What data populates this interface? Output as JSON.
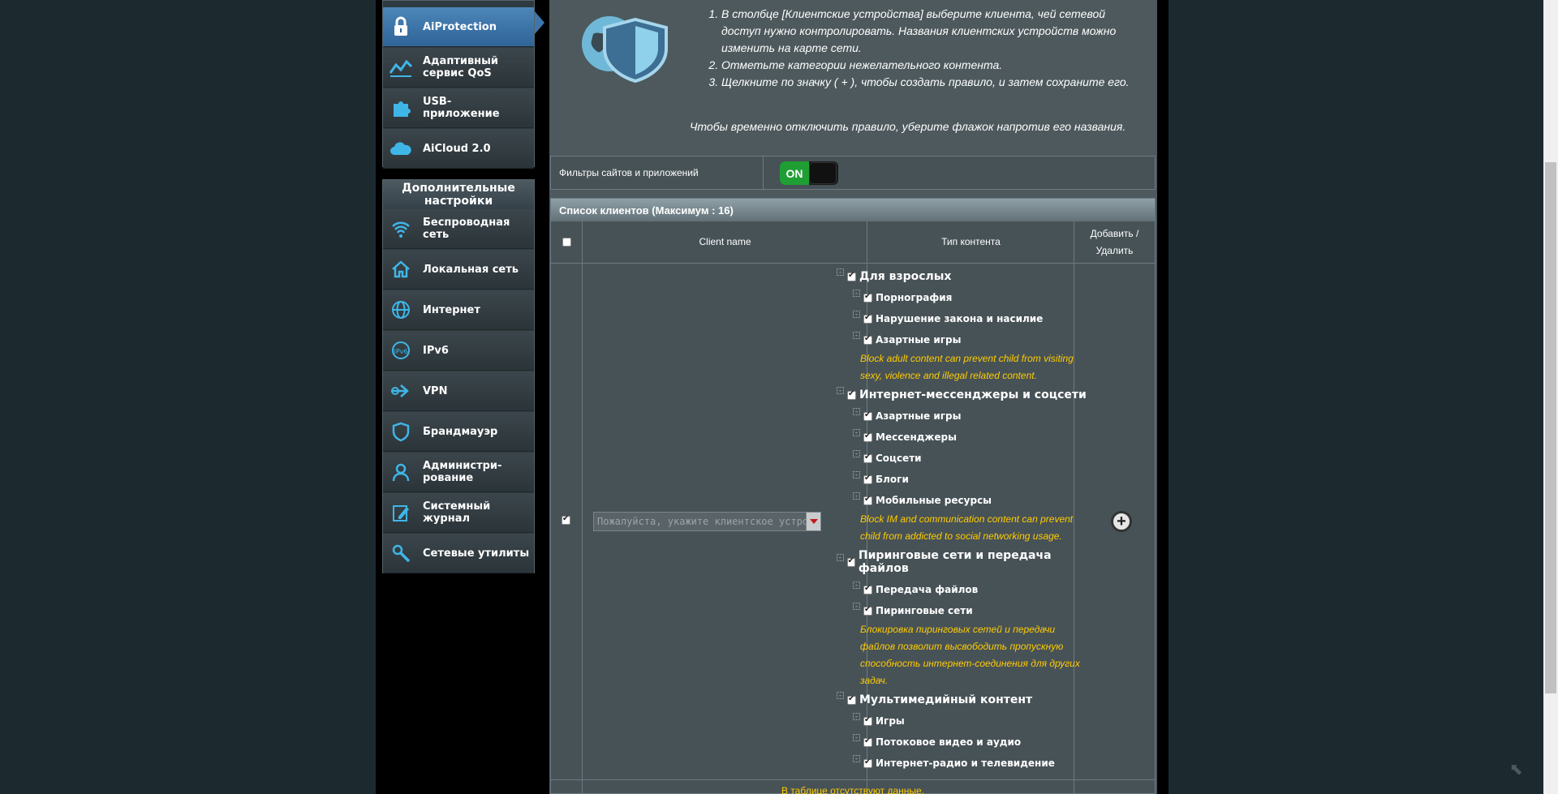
{
  "sidebar": {
    "top_items": [
      {
        "label": "AiProtection",
        "icon": "lock-icon",
        "active": true
      },
      {
        "label": "Адаптивный\nсервис QoS",
        "icon": "qos-icon"
      },
      {
        "label": "USB-\nприложение",
        "icon": "puzzle-icon"
      },
      {
        "label": "AiCloud 2.0",
        "icon": "cloud-icon"
      }
    ],
    "advanced_header": "Дополнительные настройки",
    "advanced_items": [
      {
        "label": "Беспроводная\nсеть",
        "icon": "wifi-icon"
      },
      {
        "label": "Локальная сеть",
        "icon": "home-icon"
      },
      {
        "label": "Интернет",
        "icon": "globe-icon"
      },
      {
        "label": "IPv6",
        "icon": "ipv6-icon"
      },
      {
        "label": "VPN",
        "icon": "vpn-icon"
      },
      {
        "label": "Брандмауэр",
        "icon": "shield-icon"
      },
      {
        "label": "Администри-\nрование",
        "icon": "admin-icon"
      },
      {
        "label": "Системный\nжурнал",
        "icon": "log-icon"
      },
      {
        "label": "Сетевые утилиты",
        "icon": "tools-icon"
      }
    ]
  },
  "intro": {
    "steps": [
      "В столбце [Клиентские устройства] выберите клиента, чей сетевой доступ нужно контролировать. Названия клиентских устройств можно изменить на карте сети.",
      "Отметьте категории нежелательного контента.",
      "Щелкните по значку ( + ), чтобы создать правило, и затем сохраните его."
    ],
    "note": "Чтобы временно отключить правило, уберите флажок напротив его названия."
  },
  "filter": {
    "label": "Фильтры сайтов и приложений",
    "toggle_label": "ON"
  },
  "table": {
    "title": "Список клиентов (Максимум :  16)",
    "col_client": "Client name",
    "col_content": "Тип контента",
    "col_action": "Добавить / Удалить",
    "client_placeholder": "Пожалуйста, укажите клиентское устройство",
    "no_data": "В таблице отсутствуют данные."
  },
  "categories": [
    {
      "name": "Для взрослых",
      "subs": [
        "Порнография",
        "Нарушение закона и насилие",
        "Азартные игры"
      ],
      "desc": "Block adult content can prevent child from visiting sexy, violence and illegal related content."
    },
    {
      "name": "Интернет-мессенджеры и соцсети",
      "subs": [
        "Азартные игры",
        "Мессенджеры",
        "Соцсети",
        "Блоги",
        "Мобильные ресурсы"
      ],
      "desc": "Block IM and communication content can prevent child from addicted to social networking usage."
    },
    {
      "name": "Пиринговые сети и передача файлов",
      "subs": [
        "Передача файлов",
        "Пиринговые сети"
      ],
      "desc": "Блокировка пиринговых сетей и передачи файлов позволит высвободить пропускную способность интернет-соединения для других задач."
    },
    {
      "name": "Мультимедийный контент",
      "subs": [
        "Игры",
        "Потоковое видео и аудио",
        "Интернет-радио и телевидение"
      ],
      "desc": ""
    }
  ],
  "colors": {
    "accent": "#2f6497",
    "toggle_on": "#1f9e34",
    "warning_text": "#ffcc00"
  }
}
